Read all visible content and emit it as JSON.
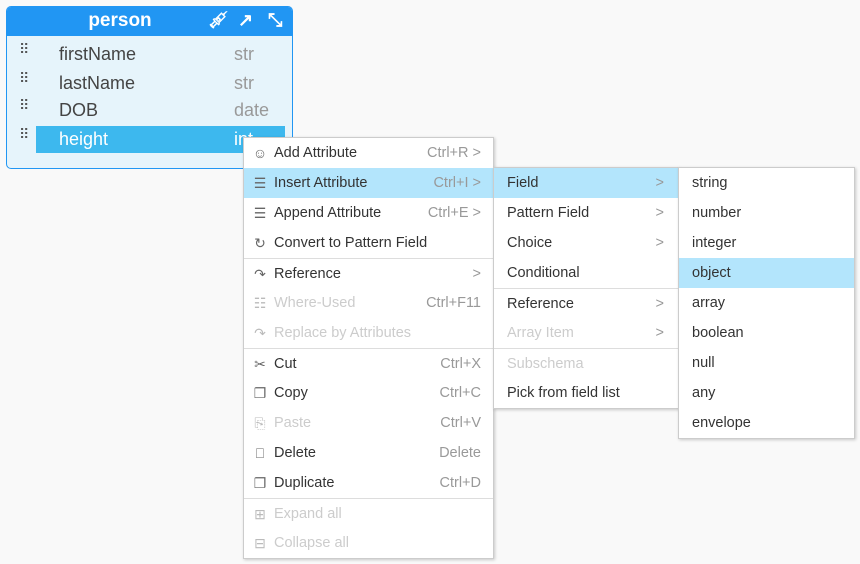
{
  "entity": {
    "title": "person",
    "icons": [
      "eyedropper-icon",
      "open-external-icon",
      "expand-icon"
    ],
    "rows": [
      {
        "name": "firstName",
        "type": "str"
      },
      {
        "name": "lastName",
        "type": "str"
      },
      {
        "name": "DOB",
        "type": "date"
      },
      {
        "name": "height",
        "type": "int",
        "selected": true
      }
    ]
  },
  "menu1": [
    {
      "label": "Add Attribute",
      "shortcut": "Ctrl+R >",
      "icon": "add-user-icon"
    },
    {
      "label": "Insert Attribute",
      "shortcut": "Ctrl+I >",
      "icon": "insert-list-icon",
      "highlighted": true
    },
    {
      "label": "Append Attribute",
      "shortcut": "Ctrl+E >",
      "icon": "append-list-icon"
    },
    {
      "label": "Convert to Pattern Field",
      "shortcut": "",
      "icon": "convert-icon"
    },
    {
      "label": "Reference",
      "shortcut": ">",
      "icon": "reference-arrow-icon"
    },
    {
      "label": "Where-Used",
      "shortcut": "Ctrl+F11",
      "icon": "where-used-icon",
      "disabled": true
    },
    {
      "label": "Replace by Attributes",
      "shortcut": "",
      "icon": "replace-arrow-icon",
      "disabled": true
    },
    {
      "label": "Cut",
      "shortcut": "Ctrl+X",
      "icon": "scissors-icon"
    },
    {
      "label": "Copy",
      "shortcut": "Ctrl+C",
      "icon": "copy-icon"
    },
    {
      "label": "Paste",
      "shortcut": "Ctrl+V",
      "icon": "paste-icon",
      "disabled": true
    },
    {
      "label": "Delete",
      "shortcut": "Delete",
      "icon": "trash-icon"
    },
    {
      "label": "Duplicate",
      "shortcut": "Ctrl+D",
      "icon": "duplicate-icon"
    },
    {
      "label": "Expand all",
      "shortcut": "",
      "icon": "expand-all-icon",
      "disabled": true
    },
    {
      "label": "Collapse all",
      "shortcut": "",
      "icon": "collapse-all-icon",
      "disabled": true
    }
  ],
  "menu2": [
    {
      "label": "Field",
      "arrow": ">",
      "highlighted": true
    },
    {
      "label": "Pattern Field",
      "arrow": ">"
    },
    {
      "label": "Choice",
      "arrow": ">"
    },
    {
      "label": "Conditional",
      "arrow": ""
    },
    {
      "label": "Reference",
      "arrow": ">"
    },
    {
      "label": "Array Item",
      "arrow": ">",
      "disabled": true
    },
    {
      "label": "Subschema",
      "arrow": "",
      "disabled": true
    },
    {
      "label": "Pick from field list",
      "arrow": ""
    }
  ],
  "menu3": [
    "string",
    "number",
    "integer",
    "object",
    "array",
    "boolean",
    "null",
    "any",
    "envelope"
  ],
  "menu3_selected": "object",
  "colors": {
    "header": "#2196f3",
    "selected_row": "#3db8ee",
    "menu_highlight": "#b3e5fc"
  }
}
